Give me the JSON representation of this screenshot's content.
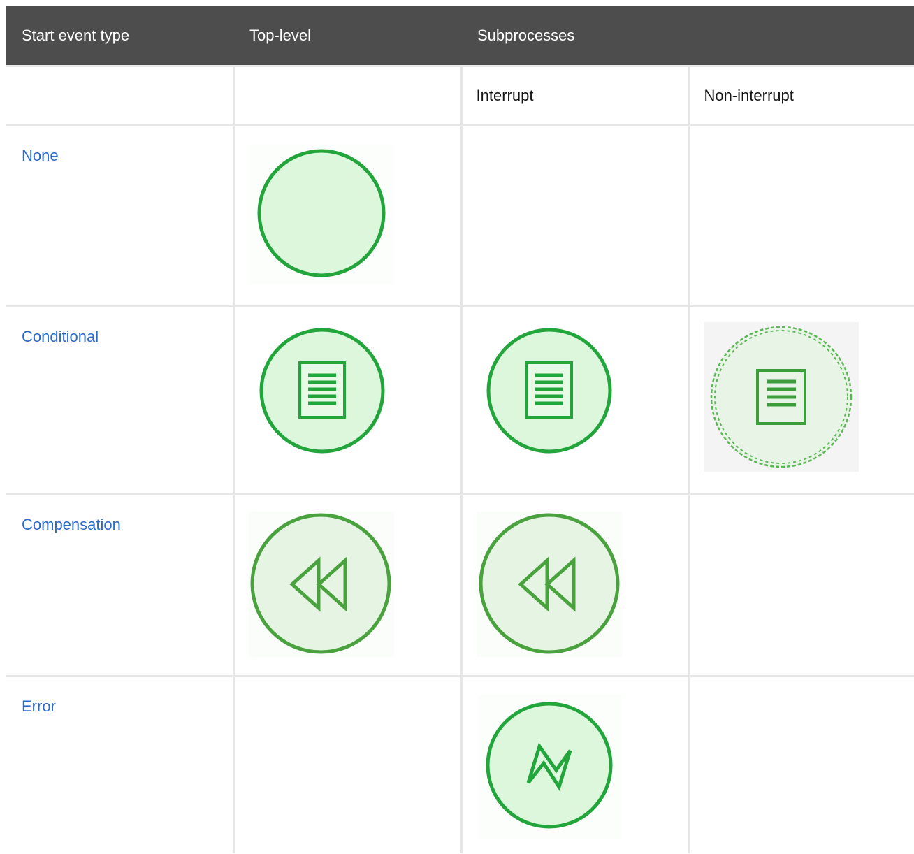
{
  "table": {
    "headers": [
      "Start event type",
      "Top-level",
      "Subprocesses"
    ],
    "subheaders": [
      "",
      "",
      "Interrupt",
      "Non-interrupt"
    ],
    "rows": [
      {
        "type": "None",
        "icons": [
          "none-start-event-icon",
          "",
          "",
          ""
        ]
      },
      {
        "type": "Conditional",
        "icons": [
          "conditional-start-event-icon",
          "conditional-interrupt-start-event-icon",
          "conditional-non-interrupt-start-event-icon"
        ]
      },
      {
        "type": "Compensation",
        "icons": [
          "compensation-start-event-icon",
          "compensation-interrupt-start-event-icon"
        ]
      },
      {
        "type": "Error",
        "icons": [
          "error-interrupt-start-event-icon"
        ]
      }
    ]
  },
  "colors": {
    "header_bg": "#4d4d4d",
    "link": "#2a6bc9",
    "event_stroke": "#22a53b",
    "event_fill": "#dcf7dc",
    "compensation_stroke": "#4aa23f",
    "compensation_fill": "#e6f5e3",
    "grid_line": "#e6e6e6"
  }
}
